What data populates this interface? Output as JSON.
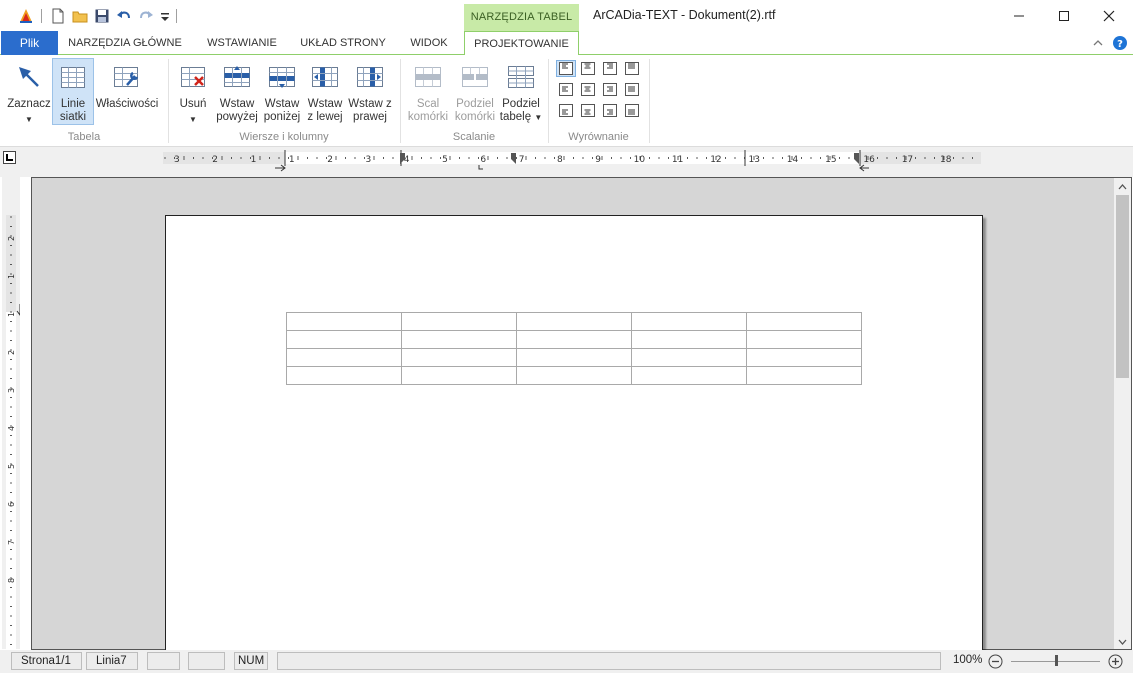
{
  "titlebar": {
    "title": "ArCADia-TEXT - Dokument(2).rtf",
    "context_tab": "NARZĘDZIA TABEL",
    "qat_icons": [
      "app-logo-icon",
      "new-document-icon",
      "open-folder-icon",
      "save-icon",
      "undo-icon",
      "redo-icon",
      "customize-qat-icon"
    ],
    "window_controls": [
      "minimize-icon",
      "maximize-icon",
      "close-icon"
    ]
  },
  "tabs": [
    {
      "id": "file",
      "label": "Plik"
    },
    {
      "id": "home",
      "label": "NARZĘDZIA GŁÓWNE"
    },
    {
      "id": "insert",
      "label": "WSTAWIANIE"
    },
    {
      "id": "layout",
      "label": "UKŁAD STRONY"
    },
    {
      "id": "view",
      "label": "WIDOK"
    },
    {
      "id": "design",
      "label": "PROJEKTOWANIE",
      "active": true
    }
  ],
  "ribbon": {
    "groups": [
      {
        "label": "Tabela"
      },
      {
        "label": "Wiersze i kolumny"
      },
      {
        "label": "Scalanie"
      },
      {
        "label": "Wyrównanie"
      }
    ],
    "buttons": {
      "select": {
        "line1": "Zaznacz",
        "line2": ""
      },
      "gridlines": {
        "line1": "Linie",
        "line2": "siatki"
      },
      "properties": {
        "line1": "Właściwości",
        "line2": ""
      },
      "delete": {
        "line1": "Usuń",
        "line2": ""
      },
      "insert_above": {
        "line1": "Wstaw",
        "line2": "powyżej"
      },
      "insert_below": {
        "line1": "Wstaw",
        "line2": "poniżej"
      },
      "insert_left": {
        "line1": "Wstaw",
        "line2": "z lewej"
      },
      "insert_right": {
        "line1": "Wstaw z",
        "line2": "prawej"
      },
      "merge_cells": {
        "line1": "Scal",
        "line2": "komórki"
      },
      "split_cells": {
        "line1": "Podziel",
        "line2": "komórki"
      },
      "split_table": {
        "line1": "Podziel",
        "line2": "tabelę"
      }
    },
    "alignment_selected": "top-left"
  },
  "ruler": {
    "h_numbers": [
      "3",
      "2",
      "1",
      "1",
      "2",
      "3",
      "4",
      "5",
      "6",
      "7",
      "8",
      "9",
      "10",
      "11",
      "12",
      "13",
      "14",
      "15",
      "16",
      "17",
      "18"
    ],
    "v_numbers": [
      "2",
      "1",
      "1",
      "2",
      "3",
      "4",
      "5",
      "6",
      "7",
      "8"
    ]
  },
  "document": {
    "table": {
      "rows": 4,
      "cols": 5
    }
  },
  "statusbar": {
    "page": "Strona1/1",
    "line": "Linia7",
    "num": "NUM",
    "zoom": "100%",
    "zoom_level_fraction": 0.5
  },
  "colors": {
    "file_tab": "#2b6dcd",
    "context_tab": "#c8eaa7",
    "accent_green": "#8fcf6a",
    "help": "#1e74d6"
  }
}
